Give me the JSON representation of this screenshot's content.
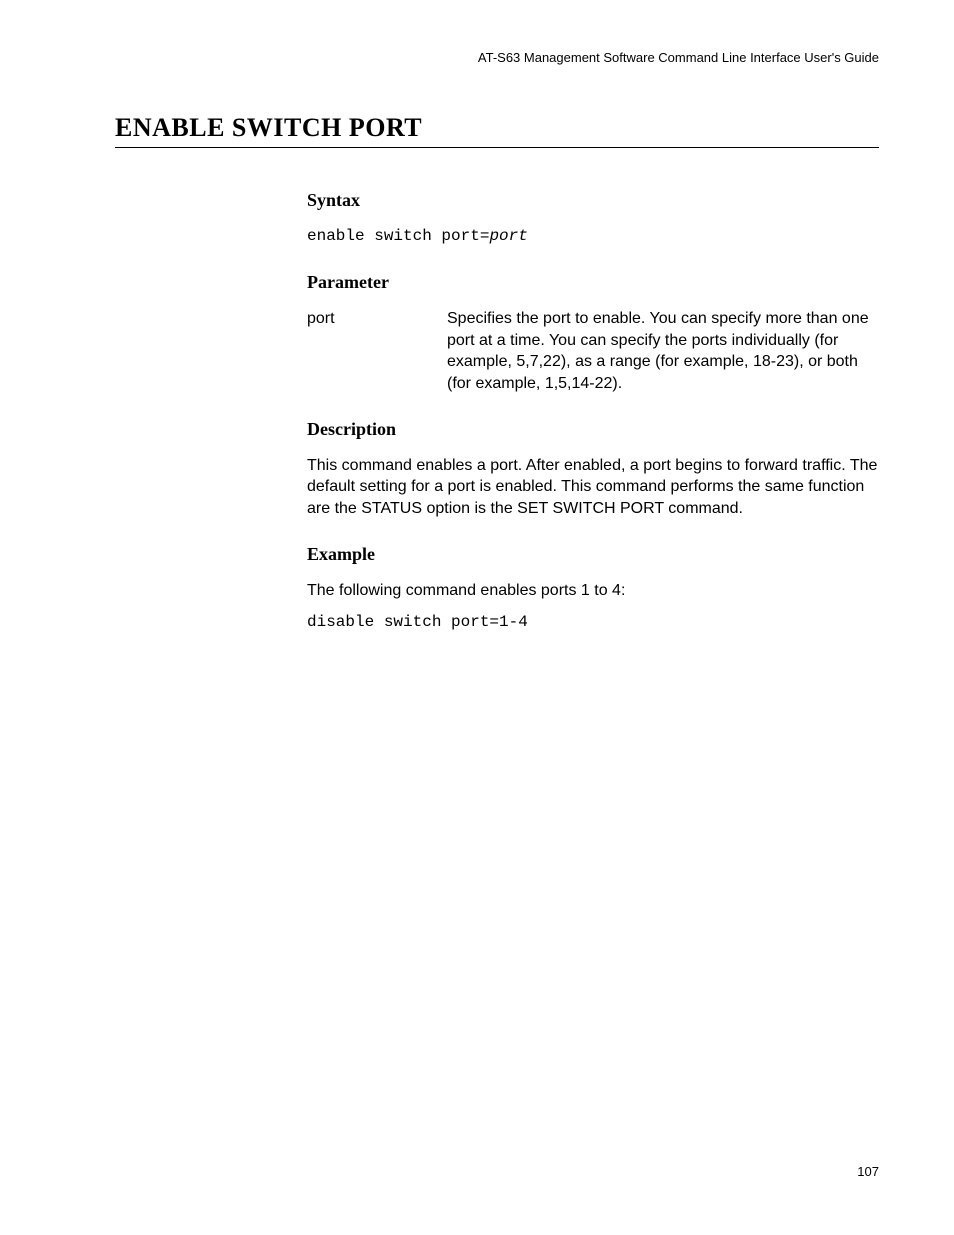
{
  "header": {
    "running": "AT-S63 Management Software Command Line Interface User's Guide"
  },
  "title": "ENABLE SWITCH PORT",
  "sections": {
    "syntax": {
      "heading": "Syntax",
      "command_prefix": "enable switch port=",
      "command_arg": "port"
    },
    "parameter": {
      "heading": "Parameter",
      "name": "port",
      "desc": "Specifies the port to enable. You can specify more than one port at a time. You can specify the ports individually (for example, 5,7,22), as a range (for example, 18-23), or both (for example, 1,5,14-22)."
    },
    "description": {
      "heading": "Description",
      "text": "This command enables a port. After enabled, a port begins to forward traffic. The default setting for a port is enabled. This command performs the same function are the STATUS option is the SET SWITCH PORT command."
    },
    "example": {
      "heading": "Example",
      "intro": "The following command enables ports 1 to 4:",
      "command": "disable switch port=1-4"
    }
  },
  "page_number": "107"
}
